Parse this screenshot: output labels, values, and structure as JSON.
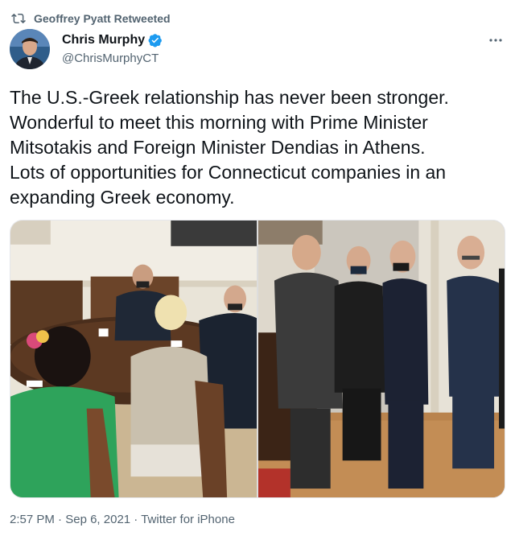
{
  "retweet": {
    "label": "Geoffrey Pyatt Retweeted",
    "icon": "retweet-icon"
  },
  "author": {
    "name": "Chris Murphy",
    "handle": "@ChrisMurphyCT",
    "verified": true,
    "verified_icon": "verified-badge-icon"
  },
  "tweet": {
    "text": "The U.S.-Greek relationship has never been stronger.\nWonderful to meet this morning with Prime Minister\nMitsotakis and Foreign Minister Dendias in Athens.\nLots of opportunities for Connecticut companies in an\nexpanding Greek economy."
  },
  "media": {
    "count": 2
  },
  "meta": {
    "time": "2:57 PM",
    "separator": " · ",
    "date": "Sep 6, 2021",
    "source": "Twitter for iPhone"
  },
  "colors": {
    "text_primary": "#0f1419",
    "text_secondary": "#536471",
    "verified_blue": "#1d9bf0"
  }
}
